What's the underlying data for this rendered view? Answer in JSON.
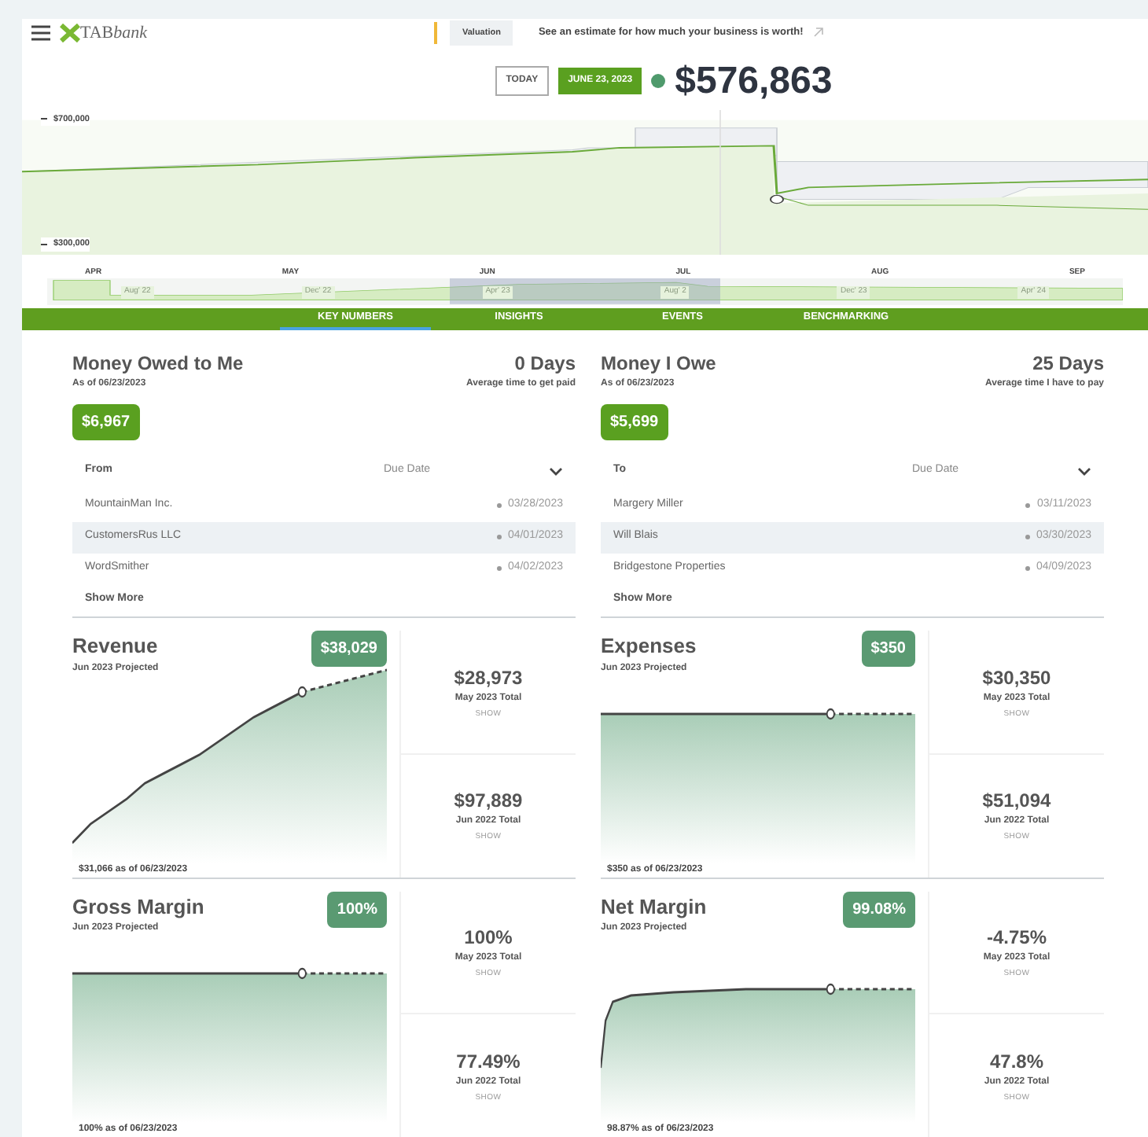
{
  "header": {
    "logo": "TAB",
    "logo_italic": "bank",
    "badge": "Valuation",
    "message": "See an estimate for how much your business is worth!"
  },
  "valuation": {
    "today": "TODAY",
    "date": "JUNE 23, 2023",
    "amount": "$576,863"
  },
  "chart": {
    "y_labels": [
      "$700,000",
      "$300,000"
    ],
    "months": [
      "APR",
      "MAY",
      "JUN",
      "JUL",
      "AUG",
      "SEP"
    ],
    "navigator_labels": [
      "Aug' 22",
      "Dec' 22",
      "Apr' 23",
      "Aug' 2",
      "Dec' 23",
      "Apr' 24"
    ]
  },
  "tabs": [
    {
      "label": "KEY NUMBERS",
      "selected": true
    },
    {
      "label": "INSIGHTS",
      "selected": false
    },
    {
      "label": "EVENTS",
      "selected": false
    },
    {
      "label": "BENCHMARKING",
      "selected": false
    }
  ],
  "money": [
    {
      "title": "Money Owed to Me",
      "as_of": "As of 06/23/2023",
      "days": "0 Days",
      "days_caption": "Average time to get paid",
      "total": "$6,967",
      "col1": "From",
      "col2": "Due Date",
      "rows": [
        {
          "name": "MountainMan Inc.",
          "date": "03/28/2023",
          "selected": false
        },
        {
          "name": "CustomersRus LLC",
          "date": "04/01/2023",
          "selected": true
        },
        {
          "name": "WordSmither",
          "date": "04/02/2023",
          "selected": false
        }
      ],
      "more": "Show More"
    },
    {
      "title": "Money I Owe",
      "as_of": "As of 06/23/2023",
      "days": "25 Days",
      "days_caption": "Average time I have to pay",
      "total": "$5,699",
      "col1": "To",
      "col2": "Due Date",
      "rows": [
        {
          "name": "Margery Miller",
          "date": "03/11/2023",
          "selected": false
        },
        {
          "name": "Will Blais",
          "date": "03/30/2023",
          "selected": true
        },
        {
          "name": "Bridgestone Properties",
          "date": "04/09/2023",
          "selected": false
        }
      ],
      "more": "Show More"
    }
  ],
  "metrics": [
    {
      "title": "Revenue",
      "subtitle": "Jun 2023 Projected",
      "value": "$38,029",
      "kind": "rising",
      "footer": "$31,066 as of 06/23/2023",
      "stats": [
        {
          "value": "$28,973",
          "label": "May 2023 Total",
          "action": "SHOW"
        },
        {
          "value": "$97,889",
          "label": "Jun 2022 Total",
          "action": "SHOW"
        }
      ]
    },
    {
      "title": "Expenses",
      "subtitle": "Jun 2023 Projected",
      "value": "$350",
      "kind": "flat",
      "footer": "$350 as of 06/23/2023",
      "stats": [
        {
          "value": "$30,350",
          "label": "May 2023 Total",
          "action": "SHOW"
        },
        {
          "value": "$51,094",
          "label": "Jun 2022 Total",
          "action": "SHOW"
        }
      ]
    },
    {
      "title": "Gross Margin",
      "subtitle": "Jun 2023 Projected",
      "value": "100%",
      "kind": "flat",
      "footer": "100% as of 06/23/2023",
      "stats": [
        {
          "value": "100%",
          "label": "May 2023 Total",
          "action": "SHOW"
        },
        {
          "value": "77.49%",
          "label": "Jun 2022 Total",
          "action": "SHOW"
        }
      ]
    },
    {
      "title": "Net Margin",
      "subtitle": "Jun 2023 Projected",
      "value": "99.08%",
      "kind": "saturating",
      "footer": "98.87% as of 06/23/2023",
      "stats": [
        {
          "value": "-4.75%",
          "label": "May 2023 Total",
          "action": "SHOW"
        },
        {
          "value": "47.8%",
          "label": "Jun 2022 Total",
          "action": "SHOW"
        }
      ]
    }
  ]
}
